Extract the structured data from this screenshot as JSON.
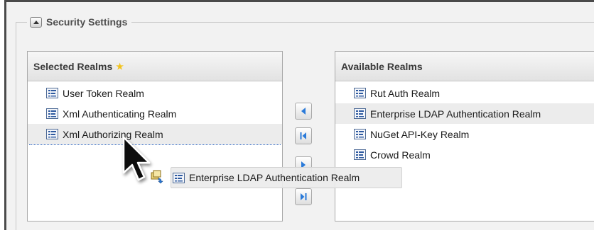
{
  "section": {
    "title": "Security Settings",
    "collapse_icon": "collapse-up-icon"
  },
  "selected": {
    "title": "Selected Realms",
    "star_icon": "star-icon",
    "items": [
      {
        "label": "User Token Realm"
      },
      {
        "label": "Xml Authenticating Realm"
      },
      {
        "label": "Xml Authorizing Realm"
      }
    ]
  },
  "available": {
    "title": "Available Realms",
    "items": [
      {
        "label": "Rut Auth Realm"
      },
      {
        "label": "Enterprise LDAP Authentication Realm"
      },
      {
        "label": "NuGet API-Key Realm"
      },
      {
        "label": "Crowd Realm"
      }
    ]
  },
  "mover_buttons": [
    "move-left",
    "move-all-left",
    "move-right",
    "move-all-right"
  ],
  "drag": {
    "label": "Enterprise LDAP Authentication Realm"
  },
  "colors": {
    "accent": "#2a7ad9",
    "header_bg": "#e8e8e8",
    "highlight": "#ececec"
  }
}
